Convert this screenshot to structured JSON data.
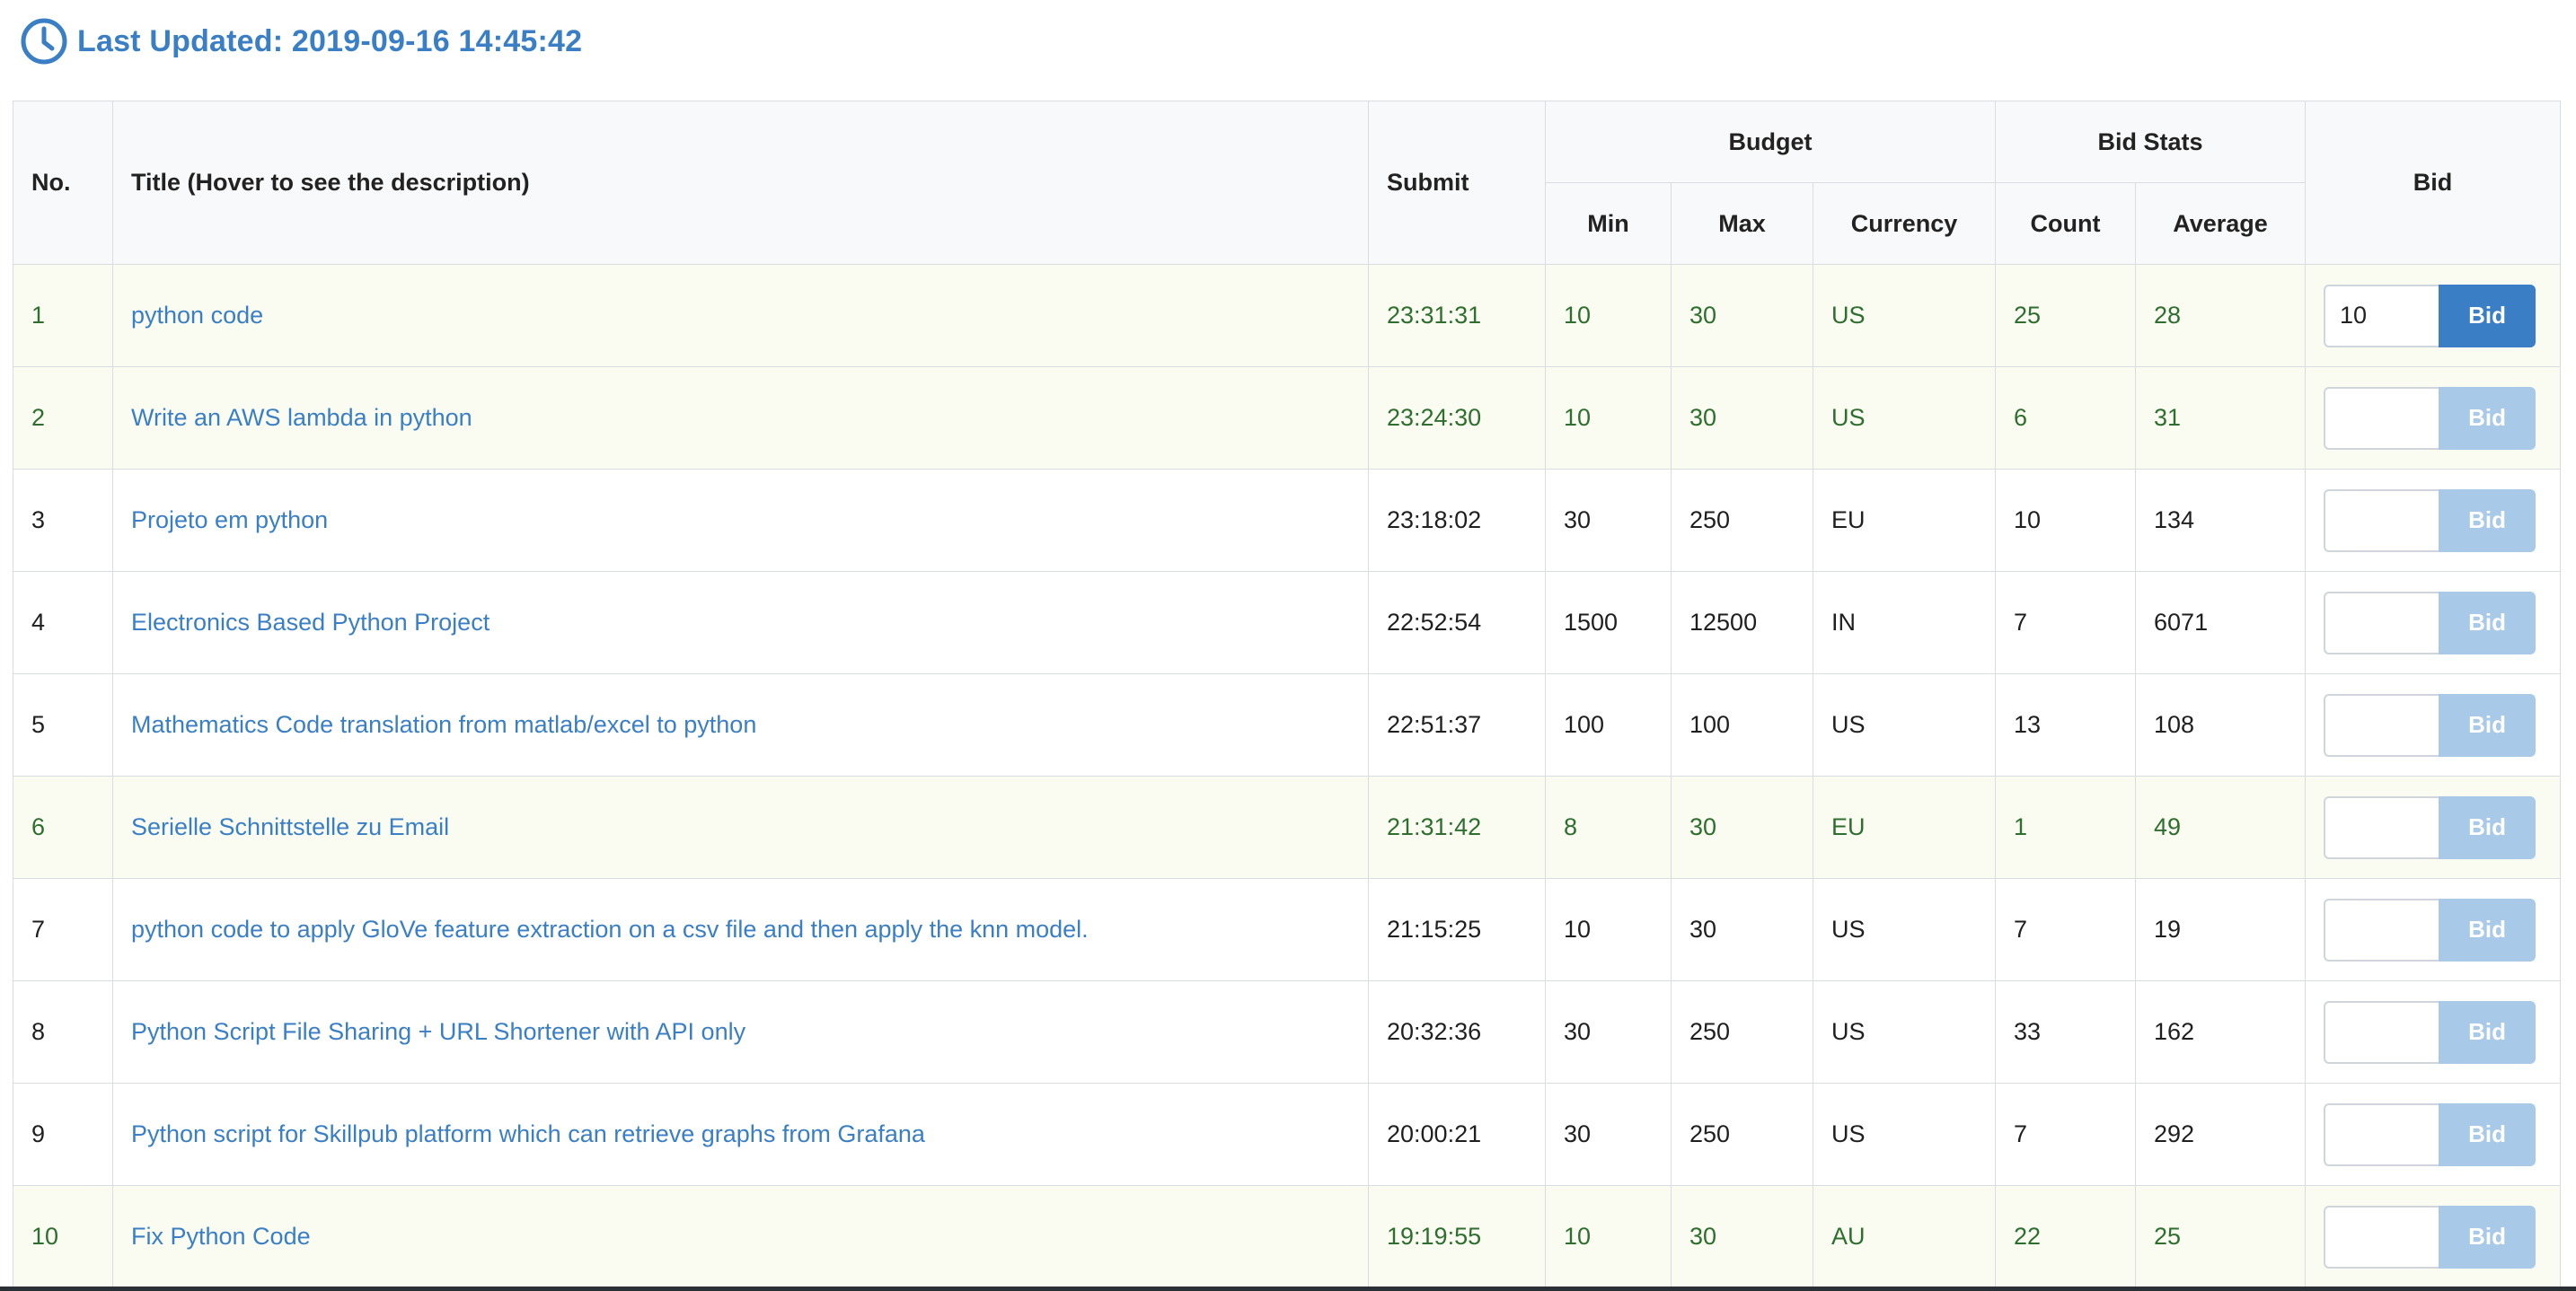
{
  "header": {
    "icon": "clock-icon",
    "text": "Last Updated: 2019-09-16 14:45:42"
  },
  "table": {
    "headers": {
      "no": "No.",
      "title": "Title (Hover to see the description)",
      "submit": "Submit",
      "budget": "Budget",
      "min": "Min",
      "max": "Max",
      "currency": "Currency",
      "bid_stats": "Bid Stats",
      "count": "Count",
      "average": "Average",
      "bid": "Bid"
    },
    "rows": [
      {
        "no": "1",
        "title": "python code",
        "submit": "23:31:31",
        "min": "10",
        "max": "30",
        "currency": "US",
        "count": "25",
        "average": "28",
        "bid_value": "10",
        "bid_label": "Bid",
        "highlight": true,
        "active": true
      },
      {
        "no": "2",
        "title": "Write an AWS lambda in python",
        "submit": "23:24:30",
        "min": "10",
        "max": "30",
        "currency": "US",
        "count": "6",
        "average": "31",
        "bid_value": "",
        "bid_label": "Bid",
        "highlight": true,
        "active": false
      },
      {
        "no": "3",
        "title": "Projeto em python",
        "submit": "23:18:02",
        "min": "30",
        "max": "250",
        "currency": "EU",
        "count": "10",
        "average": "134",
        "bid_value": "",
        "bid_label": "Bid",
        "highlight": false,
        "active": false
      },
      {
        "no": "4",
        "title": "Electronics Based Python Project",
        "submit": "22:52:54",
        "min": "1500",
        "max": "12500",
        "currency": "IN",
        "count": "7",
        "average": "6071",
        "bid_value": "",
        "bid_label": "Bid",
        "highlight": false,
        "active": false
      },
      {
        "no": "5",
        "title": "Mathematics Code translation from matlab/excel to python",
        "submit": "22:51:37",
        "min": "100",
        "max": "100",
        "currency": "US",
        "count": "13",
        "average": "108",
        "bid_value": "",
        "bid_label": "Bid",
        "highlight": false,
        "active": false
      },
      {
        "no": "6",
        "title": "Serielle Schnittstelle zu Email",
        "submit": "21:31:42",
        "min": "8",
        "max": "30",
        "currency": "EU",
        "count": "1",
        "average": "49",
        "bid_value": "",
        "bid_label": "Bid",
        "highlight": true,
        "active": false
      },
      {
        "no": "7",
        "title": "python code to apply GloVe feature extraction on a csv file and then apply the knn model.",
        "submit": "21:15:25",
        "min": "10",
        "max": "30",
        "currency": "US",
        "count": "7",
        "average": "19",
        "bid_value": "",
        "bid_label": "Bid",
        "highlight": false,
        "active": false
      },
      {
        "no": "8",
        "title": "Python Script File Sharing + URL Shortener with API only",
        "submit": "20:32:36",
        "min": "30",
        "max": "250",
        "currency": "US",
        "count": "33",
        "average": "162",
        "bid_value": "",
        "bid_label": "Bid",
        "highlight": false,
        "active": false
      },
      {
        "no": "9",
        "title": "Python script for Skillpub platform which can retrieve graphs from Grafana",
        "submit": "20:00:21",
        "min": "30",
        "max": "250",
        "currency": "US",
        "count": "7",
        "average": "292",
        "bid_value": "",
        "bid_label": "Bid",
        "highlight": false,
        "active": false
      },
      {
        "no": "10",
        "title": "Fix Python Code",
        "submit": "19:19:55",
        "min": "10",
        "max": "30",
        "currency": "AU",
        "count": "22",
        "average": "25",
        "bid_value": "",
        "bid_label": "Bid",
        "highlight": true,
        "active": false
      }
    ]
  },
  "colors": {
    "accent": "#3a7fc6",
    "button_disabled": "#a9c9e9",
    "highlight_row_bg": "#fafcf1",
    "highlight_row_text": "#2e6e2e"
  }
}
